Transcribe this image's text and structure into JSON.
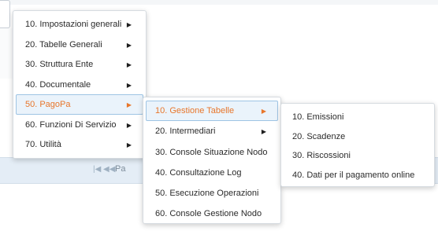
{
  "menu_level1": {
    "items": [
      {
        "label": "10. Impostazioni generali",
        "arrow": "▶",
        "active": false
      },
      {
        "label": "20. Tabelle Generali",
        "arrow": "▶",
        "active": false
      },
      {
        "label": "30. Struttura Ente",
        "arrow": "▶",
        "active": false
      },
      {
        "label": "40. Documentale",
        "arrow": "▶",
        "active": false
      },
      {
        "label": "50. PagoPa",
        "arrow": "▶",
        "active": true
      },
      {
        "label": "60. Funzioni Di Servizio",
        "arrow": "▶",
        "active": false
      },
      {
        "label": "70. Utilità",
        "arrow": "▶",
        "active": false
      }
    ]
  },
  "menu_level2": {
    "items": [
      {
        "label": "10. Gestione Tabelle",
        "arrow": "▶",
        "active": true
      },
      {
        "label": "20. Intermediari",
        "arrow": "▶",
        "active": false
      },
      {
        "label": "30. Console Situazione Nodo",
        "active": false
      },
      {
        "label": "40. Consultazione Log",
        "active": false
      },
      {
        "label": "50. Esecuzione Operazioni",
        "active": false
      },
      {
        "label": "60. Console Gestione Nodo",
        "active": false
      }
    ]
  },
  "menu_level3": {
    "items": [
      {
        "label": "10. Emissioni"
      },
      {
        "label": "20. Scadenze"
      },
      {
        "label": "30. Riscossioni"
      },
      {
        "label": "40. Dati per il pagamento online"
      }
    ]
  },
  "pager": {
    "first_icon": "first-page-icon",
    "first_glyph": "|◀",
    "prev_icon": "prev-page-icon",
    "prev_glyph": "◀◀",
    "label_fragment": "Pa"
  },
  "colors": {
    "active_text": "#e8762b",
    "active_bg": "#eaf3fb",
    "active_border": "#9ec4e4",
    "pager_bg": "#e4edf6"
  }
}
